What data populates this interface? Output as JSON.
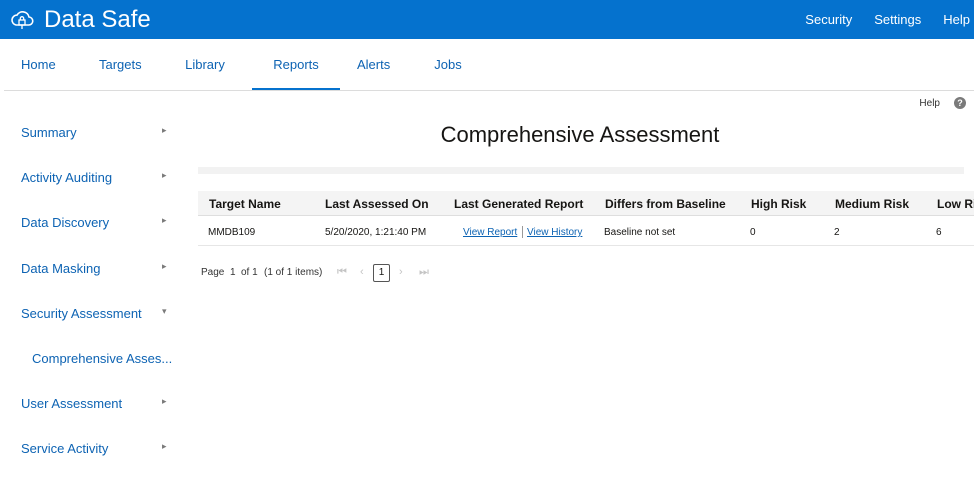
{
  "header": {
    "brand": "Data Safe",
    "links": [
      "Security",
      "Settings",
      "Help"
    ]
  },
  "nav": {
    "tabs": [
      "Home",
      "Targets",
      "Library",
      "Reports",
      "Alerts",
      "Jobs"
    ],
    "active": "Reports"
  },
  "sidebar": {
    "items": [
      {
        "label": "Summary",
        "arrow": "▸"
      },
      {
        "label": "Activity Auditing",
        "arrow": "▸"
      },
      {
        "label": "Data Discovery",
        "arrow": "▸"
      },
      {
        "label": "Data Masking",
        "arrow": "▸"
      },
      {
        "label": "Security Assessment",
        "arrow": "▾"
      },
      {
        "label": "Comprehensive Asses...",
        "arrow": ""
      },
      {
        "label": "User Assessment",
        "arrow": "▸"
      },
      {
        "label": "Service Activity",
        "arrow": "▸"
      }
    ]
  },
  "help": {
    "label": "Help",
    "icon": "?"
  },
  "page": {
    "title": "Comprehensive Assessment"
  },
  "table": {
    "columns": [
      "Target Name",
      "Last Assessed On",
      "Last Generated Report",
      "Differs from Baseline",
      "High Risk",
      "Medium Risk",
      "Low Risk"
    ],
    "rows": [
      {
        "target": "MMDB109",
        "assessed": "5/20/2020, 1:21:40 PM",
        "view_report": "View Report",
        "view_history": "View History",
        "baseline": "Baseline not set",
        "high": "0",
        "medium": "2",
        "low": "6"
      }
    ]
  },
  "pager": {
    "page_label": "Page",
    "page": "1",
    "of": "of 1",
    "items": "(1 of 1 items)",
    "first": "⏮",
    "prev": "‹",
    "current": "1",
    "next": "›",
    "last": "⏭"
  }
}
